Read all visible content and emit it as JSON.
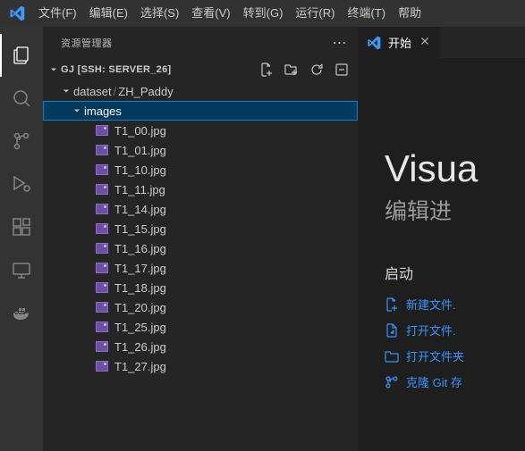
{
  "menubar": {
    "items": [
      "文件(F)",
      "编辑(E)",
      "选择(S)",
      "查看(V)",
      "转到(G)",
      "运行(R)",
      "终端(T)",
      "帮助"
    ]
  },
  "sidebar": {
    "title": "资源管理器",
    "root": {
      "label": "GJ [SSH: SERVER_26]"
    },
    "folder1": {
      "name": "dataset",
      "sub": "ZH_Paddy"
    },
    "folder2": {
      "name": "images"
    },
    "files": [
      "T1_00.jpg",
      "T1_01.jpg",
      "T1_10.jpg",
      "T1_11.jpg",
      "T1_14.jpg",
      "T1_15.jpg",
      "T1_16.jpg",
      "T1_17.jpg",
      "T1_18.jpg",
      "T1_20.jpg",
      "T1_25.jpg",
      "T1_26.jpg",
      "T1_27.jpg"
    ]
  },
  "tab": {
    "label": "开始"
  },
  "welcome": {
    "title": "Visua",
    "subtitle": "编辑进",
    "start_heading": "启动",
    "start": {
      "new_file": "新建文件.",
      "open_file": "打开文件.",
      "open_folder": "打开文件夹",
      "clone": "克隆 Git 存"
    }
  }
}
